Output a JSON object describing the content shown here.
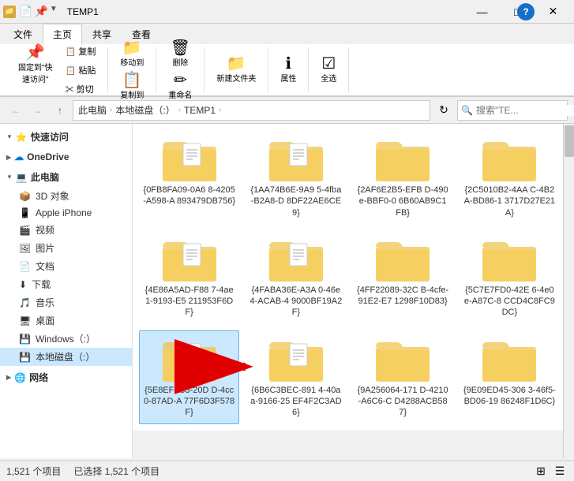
{
  "titlebar": {
    "title": "TEMP1",
    "icons": [
      "📄",
      "📄",
      "📁"
    ],
    "buttons": [
      "—",
      "□",
      "✕"
    ]
  },
  "ribbon": {
    "tabs": [
      "文件",
      "主页",
      "共享",
      "查看"
    ],
    "active_tab": "主页"
  },
  "address": {
    "back_disabled": true,
    "forward_disabled": true,
    "breadcrumbs": [
      "此电脑",
      "本地磁盘（:）",
      "TEMP1"
    ],
    "search_placeholder": "搜索\"TE..."
  },
  "sidebar": {
    "sections": [
      {
        "label": "快速访问",
        "icon": "⭐",
        "expanded": true,
        "items": []
      },
      {
        "label": "OneDrive",
        "icon": "☁",
        "expanded": false,
        "items": []
      },
      {
        "label": "此电脑",
        "icon": "💻",
        "expanded": true,
        "items": [
          {
            "label": "3D 对象",
            "icon": "📦"
          },
          {
            "label": "Apple iPhone",
            "icon": "📱",
            "selected": false
          },
          {
            "label": "视频",
            "icon": "🎬"
          },
          {
            "label": "图片",
            "icon": "🖼"
          },
          {
            "label": "文档",
            "icon": "📄"
          },
          {
            "label": "下载",
            "icon": "⬇"
          },
          {
            "label": "音乐",
            "icon": "🎵"
          },
          {
            "label": "桌面",
            "icon": "🖥"
          },
          {
            "label": "Windows（:）",
            "icon": "💾"
          },
          {
            "label": "本地磁盘（:）",
            "icon": "💾",
            "selected": true
          }
        ]
      },
      {
        "label": "网络",
        "icon": "🌐",
        "expanded": false,
        "items": []
      }
    ]
  },
  "folders": [
    {
      "label": "{0FB8FA09-0A6\n8-4205-A598-A\n893479DB756}",
      "has_doc": true
    },
    {
      "label": "{1AA74B6E-9A9\n5-4fba-B2A8-D\n8DF22AE6CE9}",
      "has_doc": true
    },
    {
      "label": "{2AF6E2B5-EFB\nD-490e-BBF0-0\n6B60AB9C1FB}",
      "has_doc": false
    },
    {
      "label": "{2C5010B2-4AA\nC-4B2A-BD86-1\n3717D27E21A}",
      "has_doc": false
    },
    {
      "label": "{4E86A5AD-F88\n7-4ae1-9193-E5\n211953F6DF}",
      "has_doc": true
    },
    {
      "label": "{4FABA36E-A3A\n0-46e4-ACAB-4\n9000BF19A2F}",
      "has_doc": true
    },
    {
      "label": "{4FF22089-32C\nB-4cfe-91E2-E7\n1298F10D83}",
      "has_doc": false
    },
    {
      "label": "{5C7E7FD0-42E\n6-4e0e-A87C-8\nCCD4C8FC9DC}",
      "has_doc": false
    },
    {
      "label": "{5E8EF3C3-20D\nD-4cc0-87AD-A\n77F6D3F578F}",
      "has_doc": true,
      "selected": true
    },
    {
      "label": "{6B6C3BEC-891\n4-40aa-9166-25\nEF4F2C3AD6}",
      "has_doc": true
    },
    {
      "label": "{9A256064-171\nD-4210-A6C6-C\nD4288ACB587}",
      "has_doc": false
    },
    {
      "label": "{9E09ED45-306\n3-46f5-BD06-19\n86248F1D6C}",
      "has_doc": false
    }
  ],
  "status": {
    "item_count": "1,521 个项目",
    "selected_count": "已选择 1,521 个项目"
  },
  "help_btn": "?"
}
